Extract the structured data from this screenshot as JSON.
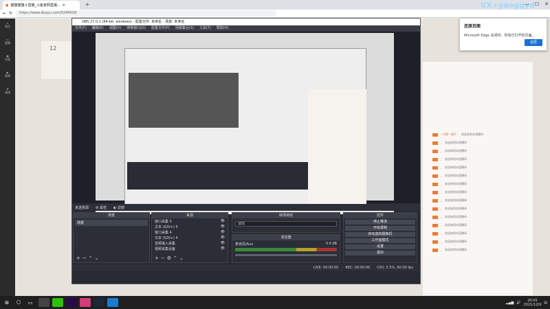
{
  "browser": {
    "tab_title": "猫猫猫猫斗直播_斗鱼官网直播...",
    "url": "https://www.douyu.com/5244018",
    "watermark": "VX+yaoggyd"
  },
  "obs": {
    "title": "OBS 27.0.1 (64-bit, windows) - 配置文件: 未命名 - 场景: 未命名",
    "menu": [
      "文件(F)",
      "编辑(E)",
      "视图(V)",
      "停靠窗口(D)",
      "配置文件(P)",
      "场景集合(S)",
      "工具(T)",
      "帮助(H)"
    ],
    "scene_bar": {
      "label": "未选择源",
      "properties": "属性",
      "filters": "滤镜"
    },
    "docks": {
      "scenes": {
        "header": "场景",
        "items": [
          "场景"
        ]
      },
      "sources": {
        "header": "来源",
        "items": [
          "窗口采集 5",
          "文本 (GDI+) 5",
          "窗口采集 4",
          "文本 (GDI+) 4",
          "音频输入采集",
          "视频采集设备"
        ]
      },
      "transition": {
        "header": "转场特效",
        "value": "淡出"
      },
      "mixer": {
        "header": "混音器",
        "channel": "麦克风/Aux",
        "db": "0.0 dB"
      },
      "controls": {
        "header": "控件",
        "buttons": [
          "停止推流",
          "开始录制",
          "启动虚拟摄像机",
          "工作室模式",
          "设置",
          "退出"
        ]
      }
    },
    "status": {
      "live": "LIVE: 00:00:00",
      "rec": "REC: 00:00:00",
      "cpu": "CPU: 5.5%, 60.00 fps"
    }
  },
  "douyu": {
    "nav": [
      "首页",
      "直播",
      "分类",
      "视频",
      "游戏"
    ],
    "anchor_num": "12",
    "chat": [
      {
        "name": "一大帮一团子…",
        "text": "欢迎来到本直播间"
      },
      {
        "name": "…",
        "text": "欢迎来到本直播间"
      },
      {
        "name": "…",
        "text": "欢迎来到本直播间"
      },
      {
        "name": "…",
        "text": "欢迎来到本直播间"
      },
      {
        "name": "…",
        "text": "欢迎来到本直播间"
      },
      {
        "name": "…",
        "text": "欢迎来到本直播间"
      },
      {
        "name": "…",
        "text": "欢迎来到本直播间"
      },
      {
        "name": "…",
        "text": "欢迎来到本直播间"
      },
      {
        "name": "…",
        "text": "欢迎来到本直播间"
      },
      {
        "name": "…",
        "text": "欢迎来到本直播间"
      },
      {
        "name": "…",
        "text": "欢迎来到本直播间"
      },
      {
        "name": "…",
        "text": "欢迎来到本直播间"
      },
      {
        "name": "…",
        "text": "欢迎来到本直播间"
      },
      {
        "name": "…",
        "text": "欢迎来到本直播间"
      },
      {
        "name": "…",
        "text": "欢迎来到本直播间"
      }
    ]
  },
  "notification": {
    "title": "还原页面",
    "body": "Microsoft Edge 关闭时，你有已打开的页面。",
    "button": "还原"
  },
  "taskbar": {
    "time": "20:05",
    "date": "2021/12/9",
    "apps": [
      {
        "icon": "obs-icon",
        "color": "#444444"
      },
      {
        "icon": "wechat-icon",
        "color": "#2dc100"
      },
      {
        "icon": "premiere-icon",
        "color": "#2a0a4a"
      },
      {
        "icon": "media-icon",
        "color": "#d13c7a"
      },
      {
        "icon": "steam-icon",
        "color": "#1b2838"
      },
      {
        "icon": "edge-icon",
        "color": "#1a7bd1"
      }
    ]
  }
}
